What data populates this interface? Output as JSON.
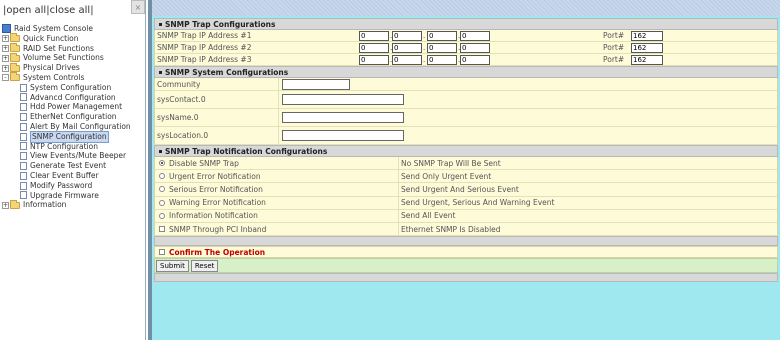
{
  "left": {
    "top_links": [
      "open all",
      "close all"
    ],
    "collapse_glyph": "×",
    "tree": [
      {
        "label": "Raid System Console",
        "level": 0,
        "icon": "console-icon"
      },
      {
        "label": "Quick Function",
        "level": 1,
        "icon": "folder-icon",
        "expander": "+"
      },
      {
        "label": "RAID Set Functions",
        "level": 1,
        "icon": "folder-icon",
        "expander": "+"
      },
      {
        "label": "Volume Set Functions",
        "level": 1,
        "icon": "folder-icon",
        "expander": "+"
      },
      {
        "label": "Physical Drives",
        "level": 1,
        "icon": "folder-icon",
        "expander": "+"
      },
      {
        "label": "System Controls",
        "level": 1,
        "icon": "folder-icon",
        "expander": "-"
      },
      {
        "label": "System Configuration",
        "level": 2,
        "icon": "page-icon"
      },
      {
        "label": "Advancd Configuration",
        "level": 2,
        "icon": "page-icon"
      },
      {
        "label": "Hdd Power Management",
        "level": 2,
        "icon": "page-icon"
      },
      {
        "label": "EtherNet Configuration",
        "level": 2,
        "icon": "page-icon"
      },
      {
        "label": "Alert By Mail Configuration",
        "level": 2,
        "icon": "page-icon"
      },
      {
        "label": "SNMP Configuration",
        "level": 2,
        "icon": "page-icon",
        "selected": true
      },
      {
        "label": "NTP Configuration",
        "level": 2,
        "icon": "page-icon"
      },
      {
        "label": "View Events/Mute Beeper",
        "level": 2,
        "icon": "page-icon"
      },
      {
        "label": "Generate Test Event",
        "level": 2,
        "icon": "page-icon"
      },
      {
        "label": "Clear Event Buffer",
        "level": 2,
        "icon": "page-icon"
      },
      {
        "label": "Modify Password",
        "level": 2,
        "icon": "page-icon"
      },
      {
        "label": "Upgrade Firmware",
        "level": 2,
        "icon": "page-icon"
      },
      {
        "label": "Information",
        "level": 1,
        "icon": "folder-icon",
        "expander": "+"
      }
    ]
  },
  "trap": {
    "title": "SNMP Trap Configurations",
    "rows": [
      {
        "label": "SNMP Trap IP Address #1",
        "ip": [
          "0",
          "0",
          "0",
          "0"
        ],
        "port_label": "Port#",
        "port": "162"
      },
      {
        "label": "SNMP Trap IP Address #2",
        "ip": [
          "0",
          "0",
          "0",
          "0"
        ],
        "port_label": "Port#",
        "port": "162"
      },
      {
        "label": "SNMP Trap IP Address #3",
        "ip": [
          "0",
          "0",
          "0",
          "0"
        ],
        "port_label": "Port#",
        "port": "162"
      }
    ]
  },
  "system": {
    "title": "SNMP System Configurations",
    "rows": [
      {
        "label": "Community",
        "value": ""
      },
      {
        "label": "sysContact.0",
        "value": ""
      },
      {
        "label": "sysName.0",
        "value": ""
      },
      {
        "label": "sysLocation.0",
        "value": ""
      }
    ]
  },
  "notification": {
    "title": "SNMP Trap Notification Configurations",
    "options": [
      {
        "label": "Disable SNMP Trap",
        "desc": "No SNMP Trap Will Be Sent",
        "control": "radio",
        "checked": true
      },
      {
        "label": "Urgent Error Notification",
        "desc": "Send Only Urgent Event",
        "control": "radio",
        "checked": false
      },
      {
        "label": "Serious Error Notification",
        "desc": "Send Urgent And Serious Event",
        "control": "radio",
        "checked": false
      },
      {
        "label": "Warning Error Notification",
        "desc": "Send Urgent, Serious And Warning Event",
        "control": "radio",
        "checked": false
      },
      {
        "label": "Information Notification",
        "desc": "Send All Event",
        "control": "radio",
        "checked": false
      },
      {
        "label": "SNMP Through PCI Inband",
        "desc": "Ethernet SNMP Is Disabled",
        "control": "checkbox",
        "checked": false
      }
    ]
  },
  "confirm": {
    "label": "Confirm The Operation",
    "checked": false
  },
  "buttons": {
    "submit": "Submit",
    "reset": "Reset"
  }
}
